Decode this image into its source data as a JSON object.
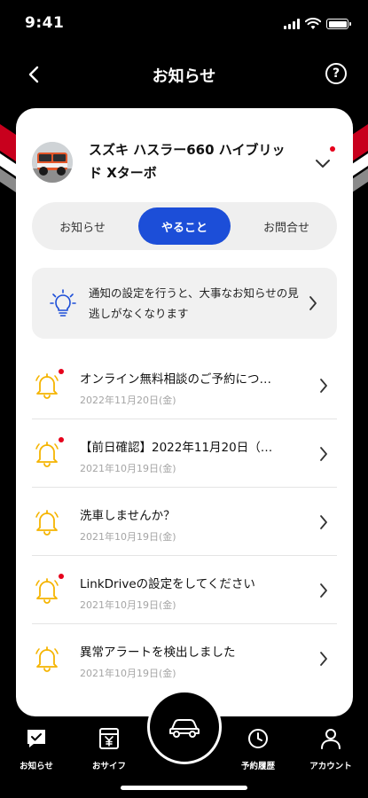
{
  "status_bar": {
    "time": "9:41"
  },
  "header": {
    "title": "お知らせ",
    "help_symbol": "?"
  },
  "vehicle": {
    "name": "スズキ ハスラー660 ハイブリッド Xターボ",
    "has_new": true
  },
  "tabs": [
    {
      "label": "お知らせ",
      "active": false
    },
    {
      "label": "やること",
      "active": true
    },
    {
      "label": "お問合せ",
      "active": false
    }
  ],
  "info_banner": {
    "text": "通知の設定を行うと、大事なお知らせの見逃しがなくなります",
    "icon": "lightbulb-icon"
  },
  "notifications": [
    {
      "title": "オンライン無料相談のご予約につ…",
      "date": "2022年11月20日(金)",
      "unread": true
    },
    {
      "title": "【前日確認】2022年11月20日（…",
      "date": "2021年10月19日(金)",
      "unread": true
    },
    {
      "title": "洗車しませんか？",
      "date": "2021年10月19日(金)",
      "unread": false
    },
    {
      "title": "LinkDriveの設定をしてください",
      "date": "2021年10月19日(金)",
      "unread": true
    },
    {
      "title": "異常アラートを検出しました",
      "date": "2021年10月19日(金)",
      "unread": false
    }
  ],
  "tabbar": {
    "items": [
      {
        "label": "お知らせ",
        "icon": "chat-check-icon"
      },
      {
        "label": "おサイフ",
        "icon": "wallet-yen-icon"
      },
      {
        "label": "",
        "icon": "car-icon"
      },
      {
        "label": "予約履歴",
        "icon": "clock-icon"
      },
      {
        "label": "アカウント",
        "icon": "person-icon"
      }
    ]
  },
  "colors": {
    "accent": "#1c4ed8",
    "badge": "#e6001b",
    "bell": "#f5b400",
    "stripe_red": "#c8001d",
    "card_bg": "#ffffff",
    "tab_bg": "#efefef",
    "date_text": "#a5a5a5"
  }
}
